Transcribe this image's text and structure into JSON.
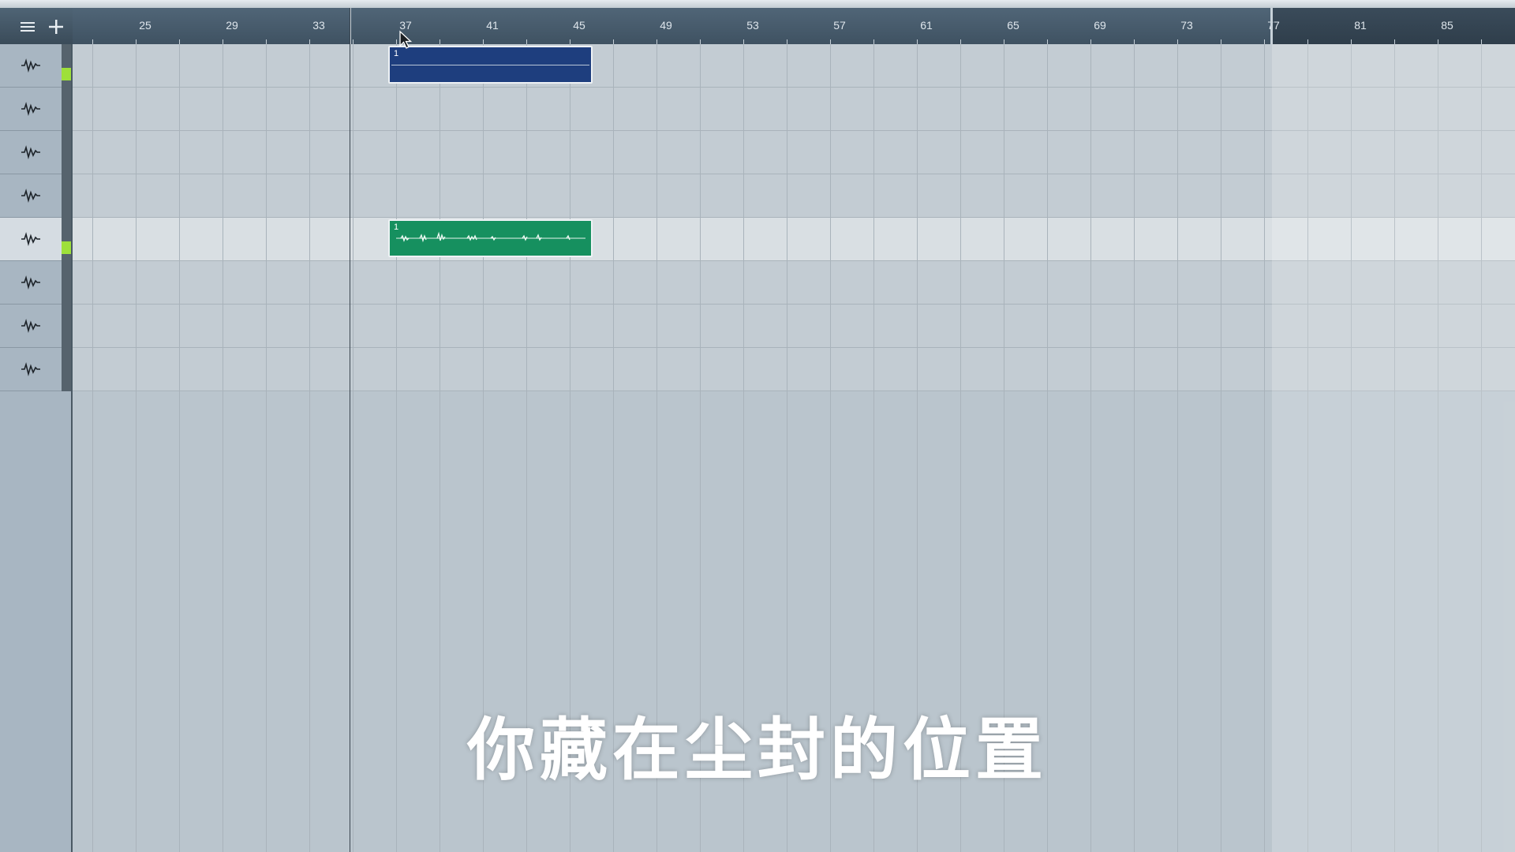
{
  "toolbar": {
    "menu_icon": "hamburger-menu-icon",
    "add_icon": "plus-icon"
  },
  "ruler": {
    "bar_labels": [
      "25",
      "29",
      "33",
      "37",
      "41",
      "45",
      "49",
      "53",
      "57",
      "61",
      "65",
      "69",
      "73",
      "77",
      "81",
      "85"
    ],
    "playhead_bar": "37"
  },
  "tracks": [
    {
      "icon": "waveform-icon",
      "selected": false,
      "meter": true
    },
    {
      "icon": "waveform-icon",
      "selected": false,
      "meter": false
    },
    {
      "icon": "waveform-icon",
      "selected": false,
      "meter": false
    },
    {
      "icon": "waveform-icon",
      "selected": false,
      "meter": false
    },
    {
      "icon": "waveform-icon",
      "selected": true,
      "meter": true
    },
    {
      "icon": "waveform-icon",
      "selected": false,
      "meter": false
    },
    {
      "icon": "waveform-icon",
      "selected": false,
      "meter": false
    },
    {
      "icon": "waveform-icon",
      "selected": false,
      "meter": false
    }
  ],
  "parts": {
    "midi": {
      "number": "1",
      "color": "#1e3e7e"
    },
    "audio": {
      "number": "1",
      "color": "#16905f"
    }
  },
  "colors": {
    "meter_green": "#9ee03a",
    "playhead": "#3b4650"
  },
  "subtitle": "你藏在尘封的位置"
}
